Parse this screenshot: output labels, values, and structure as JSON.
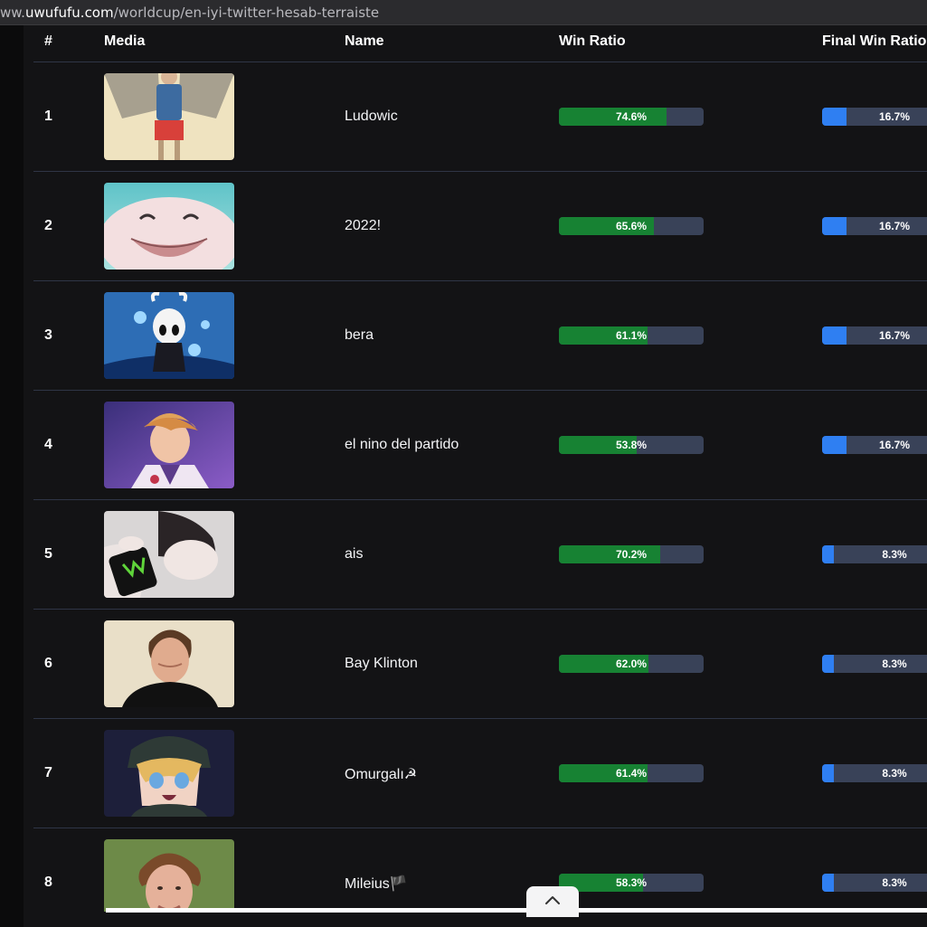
{
  "browser": {
    "url_sub": "ww.",
    "url_domain": "uwufufu.com",
    "url_path": "/worldcup/en-iyi-twitter-hesab-terraiste"
  },
  "table": {
    "headers": {
      "rank": "#",
      "media": "Media",
      "name": "Name",
      "win_ratio": "Win Ratio",
      "final_win_ratio": "Final Win Ratio"
    },
    "rows": [
      {
        "rank": "1",
        "name": "Ludowic",
        "win_ratio": 74.6,
        "win_label": "74.6%",
        "final_ratio": 16.7,
        "final_label": "16.7%"
      },
      {
        "rank": "2",
        "name": "2022!",
        "win_ratio": 65.6,
        "win_label": "65.6%",
        "final_ratio": 16.7,
        "final_label": "16.7%"
      },
      {
        "rank": "3",
        "name": "bera",
        "win_ratio": 61.1,
        "win_label": "61.1%",
        "final_ratio": 16.7,
        "final_label": "16.7%"
      },
      {
        "rank": "4",
        "name": "el nino del partido",
        "win_ratio": 53.8,
        "win_label": "53.8%",
        "final_ratio": 16.7,
        "final_label": "16.7%"
      },
      {
        "rank": "5",
        "name": "ais",
        "win_ratio": 70.2,
        "win_label": "70.2%",
        "final_ratio": 8.3,
        "final_label": "8.3%"
      },
      {
        "rank": "6",
        "name": "Bay Klinton",
        "win_ratio": 62.0,
        "win_label": "62.0%",
        "final_ratio": 8.3,
        "final_label": "8.3%"
      },
      {
        "rank": "7",
        "name": "Omurgalı☭",
        "win_ratio": 61.4,
        "win_label": "61.4%",
        "final_ratio": 8.3,
        "final_label": "8.3%"
      },
      {
        "rank": "8",
        "name": "Mileius🏴",
        "win_ratio": 58.3,
        "win_label": "58.3%",
        "final_ratio": 8.3,
        "final_label": "8.3%"
      }
    ]
  },
  "colors": {
    "win_fill": "#178233",
    "final_fill": "#2f7ff2",
    "bar_track": "#394258"
  },
  "icons": {
    "scroll_top": "chevron-up-icon"
  }
}
